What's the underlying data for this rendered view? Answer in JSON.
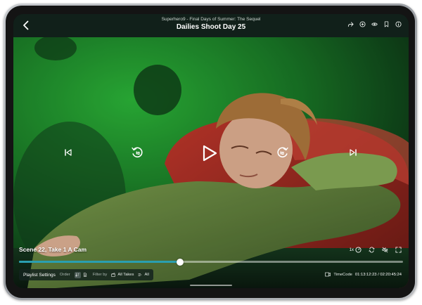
{
  "header": {
    "subtitle": "Superhero9 - Final Days of Summer: The Sequel",
    "title": "Dailies Shoot Day 25",
    "actions": [
      "share-icon",
      "add-circle-icon",
      "eye-icon",
      "bookmark-icon",
      "info-icon"
    ]
  },
  "player": {
    "scene_title": "Scene 22, Take 1 A Cam",
    "speed_label": "1x",
    "progress_fraction": 0.42
  },
  "playlist": {
    "settings_label": "Playlist Settings",
    "order_label": "Order",
    "filter_label": "Filter by",
    "takes_label": "All Takes",
    "all_label": "All"
  },
  "timecode": {
    "label": "TimeCode",
    "value": "01:13:12:23 / 02:20:45:24"
  },
  "colors": {
    "accent": "#2a9fb0",
    "bar": "#11201a"
  }
}
